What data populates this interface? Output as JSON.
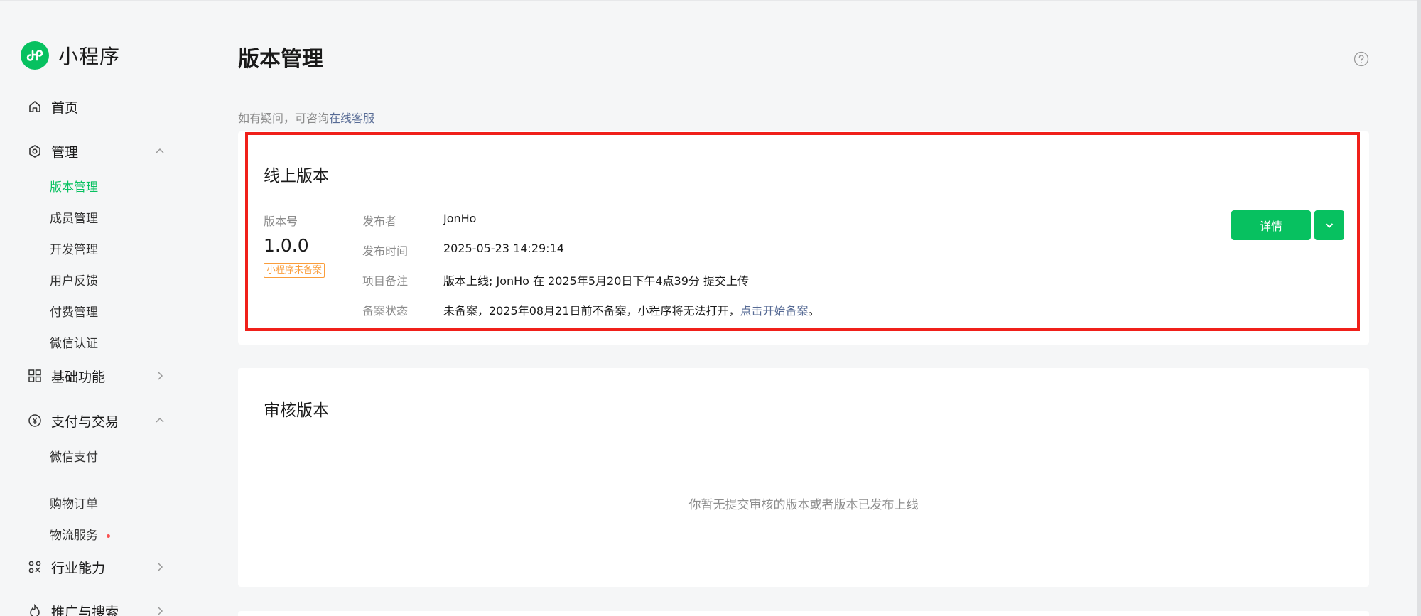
{
  "app": {
    "logo_text": "小程序"
  },
  "sidebar": {
    "home": "首页",
    "manage": {
      "label": "管理",
      "items": [
        "版本管理",
        "成员管理",
        "开发管理",
        "用户反馈",
        "付费管理",
        "微信认证"
      ]
    },
    "basic": "基础功能",
    "pay": {
      "label": "支付与交易",
      "items": [
        "微信支付",
        "购物订单",
        "物流服务"
      ]
    },
    "industry": "行业能力",
    "promo": "推广与搜索"
  },
  "main": {
    "title": "版本管理",
    "hint_prefix": "如有疑问，可咨询",
    "hint_link": "在线客服",
    "online": {
      "title": "线上版本",
      "version_label": "版本号",
      "version": "1.0.0",
      "badge": "小程序未备案",
      "publisher_key": "发布者",
      "publisher": "JonHo",
      "time_key": "发布时间",
      "time": "2025-05-23 14:29:14",
      "note_key": "项目备注",
      "note": "版本上线; JonHo 在 2025年5月20日下午4点39分 提交上传",
      "filing_key": "备案状态",
      "filing_text": "未备案，2025年08月21日前不备案，小程序将无法打开，",
      "filing_link": "点击开始备案",
      "filing_end": "。",
      "detail_button": "详情"
    },
    "review": {
      "title": "审核版本",
      "empty": "你暂无提交审核的版本或者版本已发布上线"
    }
  },
  "colors": {
    "brand_green": "#07c160",
    "link_blue": "#576b95",
    "badge_orange": "#fa9d3b",
    "highlight_red": "#f0201a"
  }
}
